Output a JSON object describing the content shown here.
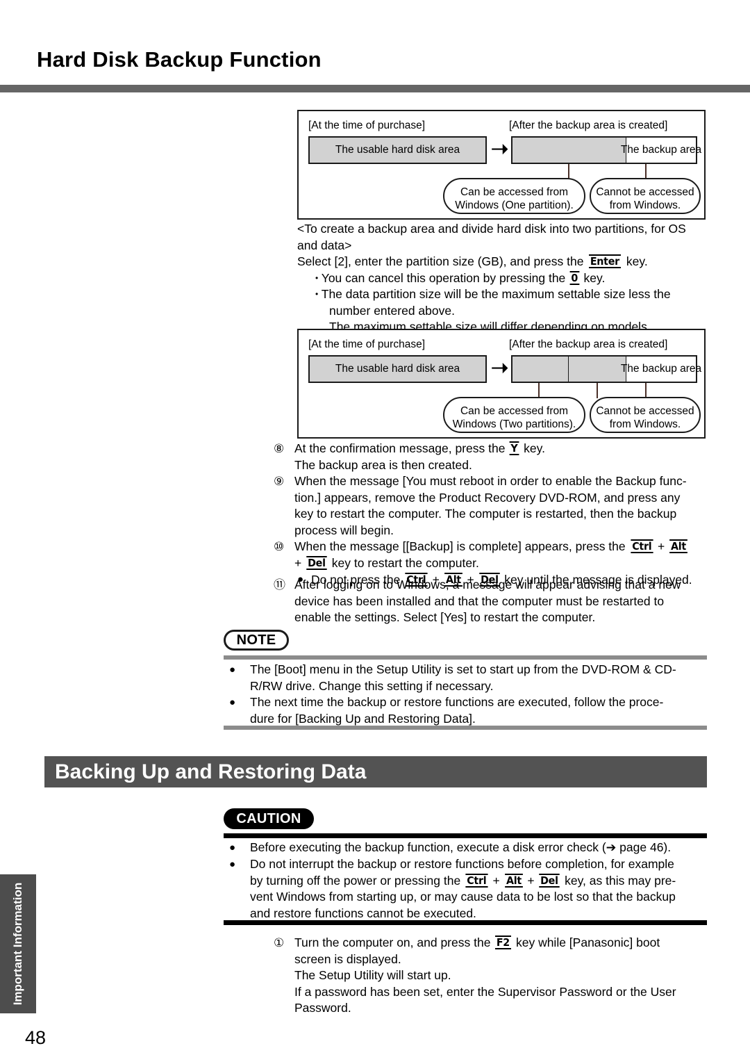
{
  "page": {
    "title": "Hard Disk Backup Function",
    "number": "48",
    "side_tab": "Important Information"
  },
  "diagram_1": {
    "caption_left": "[At the time of purchase]",
    "caption_right": "[After the backup area is created]",
    "bar_left_label": "The usable hard disk area",
    "bar_right_backup_label": "The backup area",
    "arrow": "arrow-right-icon",
    "bubble_left_line1": "Can be accessed from",
    "bubble_left_line2": "Windows (One partition).",
    "bubble_right_line1": "Cannot be accessed",
    "bubble_right_line2": "from Windows."
  },
  "middle_text": {
    "line1": "<To create a backup area and divide hard disk into two partitions, for OS",
    "line2": "and data>",
    "line3_a": "Select [2], enter the partition size (GB), and press the",
    "line3_key": "Enter",
    "line3_b": "key.",
    "bullet1_a": "You can cancel this operation by pressing the",
    "bullet1_key": "0",
    "bullet1_b": "key.",
    "bullet2_line1": "The data partition size will be the maximum settable size less the",
    "bullet2_line2": "number entered above.",
    "note_line": "The maximum settable size will differ depending on models."
  },
  "diagram_2": {
    "caption_left": "[At the time of purchase]",
    "caption_right": "[After the backup area is created]",
    "bar_left_label": "The usable hard disk area",
    "bar_right_backup_label": "The backup area",
    "arrow": "arrow-right-icon",
    "bubble_left_line1": "Can be accessed from",
    "bubble_left_line2": "Windows (Two partitions).",
    "bubble_right_line1": "Cannot be accessed",
    "bubble_right_line2": "from Windows."
  },
  "steps": [
    {
      "num": "⑧",
      "l1_a": "At the confirmation message, press the",
      "l1_key": "Y",
      "l1_b": "key.",
      "l2": "The backup area is then created."
    },
    {
      "num": "⑨",
      "l1": "When the message [You must reboot in order to enable the Backup func-",
      "l2": "tion.] appears, remove the Product Recovery DVD-ROM, and press any",
      "l3": "key to restart the computer. The computer is restarted, then the backup",
      "l4": "process will begin."
    },
    {
      "num": "⑩",
      "l1_a": "When the message [[Backup] is complete] appears, press the",
      "l1_key1": "Ctrl",
      "l1_plus": "+",
      "l1_key2": "Alt",
      "l2_plus": "+",
      "l2_key3": "Del",
      "l2_b": "key to restart the computer.",
      "sub_a": "Do not press the",
      "sub_key1": "Ctrl",
      "sub_key2": "Alt",
      "sub_key3": "Del",
      "sub_b": "key until the message is displayed."
    },
    {
      "num": "⑪",
      "l1": "After logging on to Windows, a message will appear advising that a new",
      "l2": "device has been installed and that the computer must be restarted to",
      "l3": "enable the settings.  Select [Yes] to restart the computer."
    }
  ],
  "note": {
    "tag": "NOTE",
    "items": [
      {
        "l1": "The [Boot] menu in the Setup Utility is set to start up from the DVD-ROM & CD-",
        "l2": "R/RW drive. Change this setting if necessary."
      },
      {
        "l1": "The next time the backup or restore functions are executed, follow the proce-",
        "l2": "dure for [Backing Up and Restoring Data]."
      }
    ]
  },
  "section": {
    "heading": "Backing Up and Restoring Data"
  },
  "caution": {
    "tag": "CAUTION",
    "item1": "Before executing the backup function, execute a disk error check (➔ page 46).",
    "item2_l1": "Do not interrupt the backup or restore functions before completion, for example",
    "item2_l2_a": "by turning off the power or pressing the",
    "item2_key1": "Ctrl",
    "item2_key2": "Alt",
    "item2_key3": "Del",
    "item2_l2_b": "key, as this may pre-",
    "item2_l3": "vent Windows from starting up, or may cause data to be lost so that the backup",
    "item2_l4": "and restore functions cannot be executed."
  },
  "final_step": {
    "num": "①",
    "l1_a": "Turn the computer on, and press the",
    "l1_key": "F2",
    "l1_b": "key while [Panasonic] boot",
    "l2": "screen is displayed.",
    "l3": "The Setup Utility will start up.",
    "l4": "If a password has been set, enter the Supervisor Password or the User",
    "l5": "Password."
  }
}
